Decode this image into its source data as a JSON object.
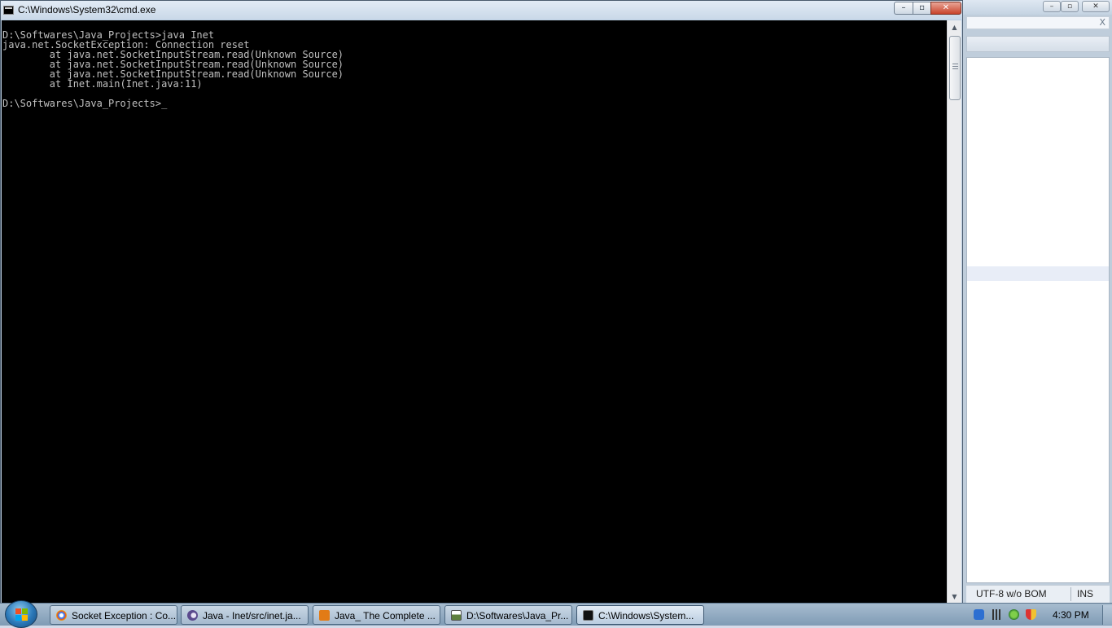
{
  "cmd_window": {
    "title": "C:\\Windows\\System32\\cmd.exe",
    "controls": {
      "minimize": "–",
      "maximize": "▫",
      "close": "✕"
    },
    "console_lines": [
      "D:\\Softwares\\Java_Projects>java Inet",
      "java.net.SocketException: Connection reset",
      "        at java.net.SocketInputStream.read(Unknown Source)",
      "        at java.net.SocketInputStream.read(Unknown Source)",
      "        at java.net.SocketInputStream.read(Unknown Source)",
      "        at Inet.main(Inet.java:11)",
      "",
      "D:\\Softwares\\Java_Projects>"
    ],
    "cursor": "_",
    "scrollbar": {
      "up": "▲",
      "down": "▼"
    }
  },
  "background_window": {
    "close_x": "X",
    "controls": {
      "minimize": "–",
      "maximize": "▫",
      "close": "✕"
    },
    "statusbar": {
      "encoding": "UTF-8 w/o BOM",
      "mode": "INS"
    }
  },
  "taskbar": {
    "tasks": [
      {
        "label": "Socket Exception : Co...",
        "icon": "chrome-icon",
        "color": "#d9442f"
      },
      {
        "label": "Java - Inet/src/inet.ja...",
        "icon": "eclipse-icon",
        "color": "#5b4a8e"
      },
      {
        "label": "Java_ The Complete ...",
        "icon": "pdf-reader-icon",
        "color": "#e27b16"
      },
      {
        "label": "D:\\Softwares\\Java_Pr...",
        "icon": "notepad-icon",
        "color": "#5e7f3d"
      },
      {
        "label": "C:\\Windows\\System...",
        "icon": "cmd-icon",
        "color": "#111111"
      }
    ],
    "clock": "4:30 PM"
  }
}
